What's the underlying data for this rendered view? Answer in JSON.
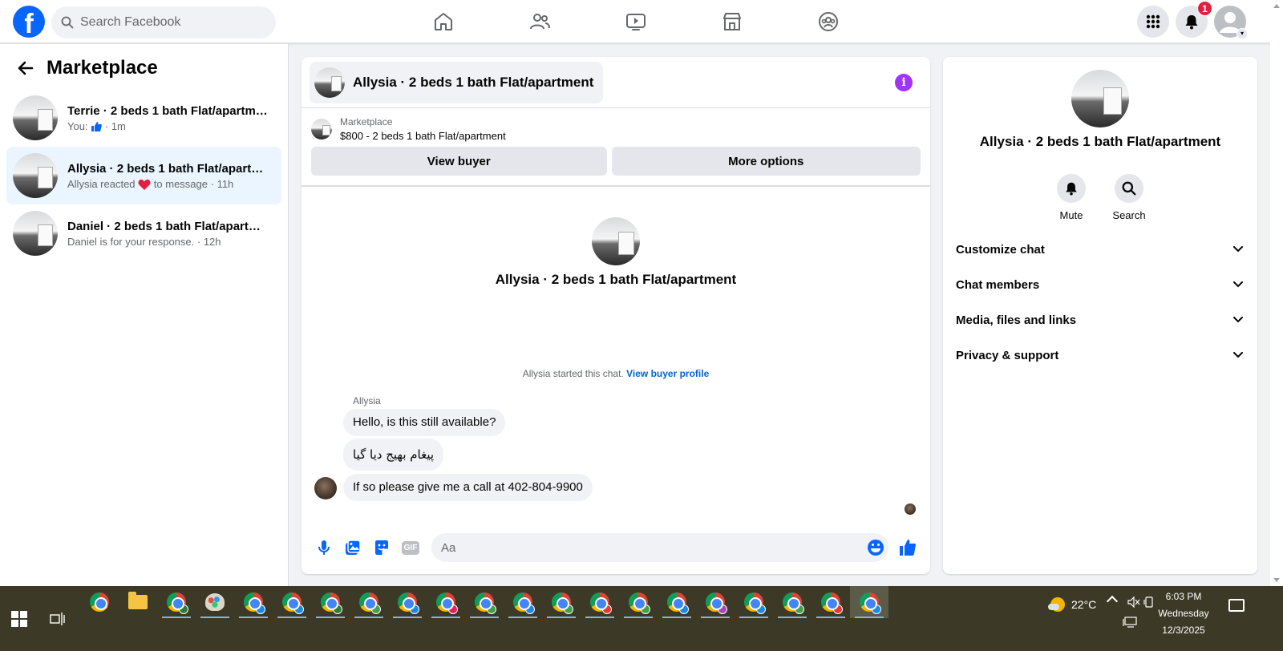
{
  "topbar": {
    "logo": "f",
    "search_placeholder": "Search Facebook",
    "notification_count": "1",
    "nav_icons": [
      "home-icon",
      "friends-icon",
      "video-icon",
      "marketplace-icon",
      "groups-icon"
    ],
    "accent_color": "#0866ff"
  },
  "sidebar": {
    "title": "Marketplace",
    "conversations": [
      {
        "name": "Terrie · 2 beds 1 bath Flat/apartment",
        "preview_prefix": "You:",
        "preview_icon": "thumbs-up-icon",
        "preview_text": "",
        "time": "· 1m",
        "active": false
      },
      {
        "name": "Allysia · 2 beds 1 bath Flat/apartm...",
        "preview_prefix": "Allysia reacted",
        "preview_icon": "heart-icon",
        "preview_text": "to message",
        "time": "· 11h",
        "active": true
      },
      {
        "name": "Daniel · 2 beds 1 bath Flat/apartm...",
        "preview_prefix": "Daniel is for your response.",
        "preview_icon": "",
        "preview_text": "",
        "time": "· 12h",
        "active": false
      }
    ]
  },
  "chat": {
    "title": "Allysia · 2 beds 1 bath Flat/apartment",
    "listing_source": "Marketplace",
    "listing_price": "$800 - 2 beds 1 bath Flat/apartment",
    "view_buyer_label": "View buyer",
    "more_options_label": "More options",
    "center_name": "Allysia · 2 beds 1 bath Flat/apartment",
    "started_text": "Allysia started this chat.",
    "view_profile_label": "View buyer profile",
    "sender_name": "Allysia",
    "messages": [
      "Hello, is this still available?",
      "پیغام بھیج دیا گیا",
      "If so please give me a call at 402-804-9900"
    ],
    "composer_placeholder": "Aa",
    "gif_label": "GIF"
  },
  "info_panel": {
    "name": "Allysia · 2 beds 1 bath Flat/apartment",
    "mute_label": "Mute",
    "search_label": "Search",
    "sections": [
      "Customize chat",
      "Chat members",
      "Media, files and links",
      "Privacy & support"
    ]
  },
  "taskbar": {
    "temperature": "22°C",
    "time": "6:03 PM",
    "day": "Wednesday",
    "date": "12/3/2025",
    "profile_colors": [
      "#2e7d32",
      "#1e88e5",
      "#1e88e5",
      "#2e7d32",
      "#43a047",
      "#1e88e5",
      "#e91e63",
      "#43a047",
      "#1e88e5",
      "#43a047",
      "#e53935",
      "#43a047",
      "#1e88e5",
      "#ab47bc",
      "#1e88e5",
      "#43a047",
      "#e53935",
      "#1e88e5"
    ]
  }
}
